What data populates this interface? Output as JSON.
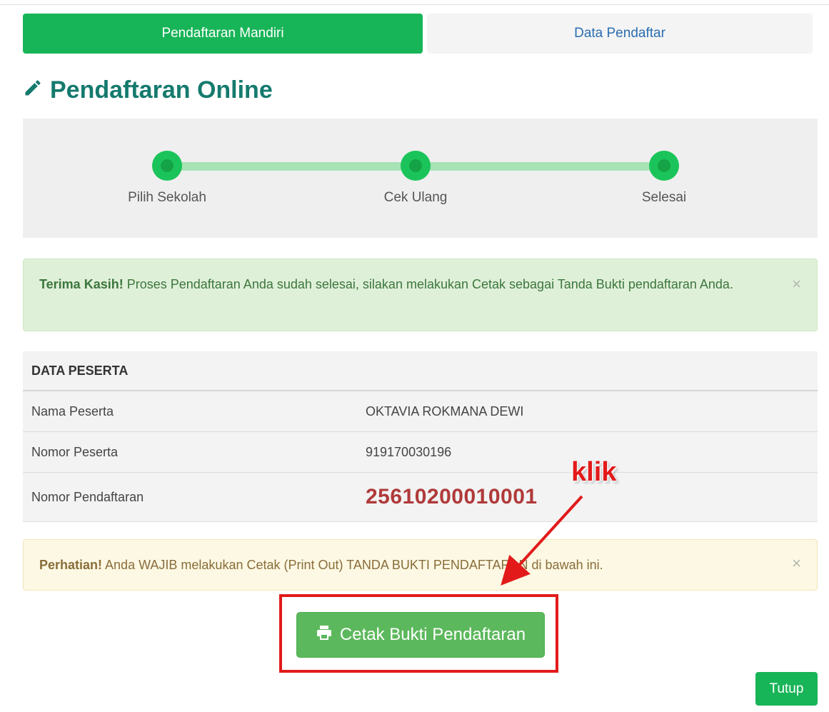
{
  "tabs": [
    {
      "label": "Pendaftaran Mandiri",
      "active": true
    },
    {
      "label": "Data Pendaftar",
      "active": false
    }
  ],
  "page_title": "Pendaftaran Online",
  "page_title_icon": "pencil-icon",
  "steps": [
    {
      "label": "Pilih Sekolah",
      "done": true
    },
    {
      "label": "Cek Ulang",
      "done": true
    },
    {
      "label": "Selesai",
      "done": true
    }
  ],
  "alert_success": {
    "strong": "Terima Kasih!",
    "text": " Proses Pendaftaran Anda sudah selesai, silakan melakukan Cetak sebagai Tanda Bukti pendaftaran Anda.",
    "close": "×"
  },
  "participant_table": {
    "header": "DATA PESERTA",
    "rows": [
      {
        "label": "Nama Peserta",
        "value": "OKTAVIA ROKMANA DEWI"
      },
      {
        "label": "Nomor Peserta",
        "value": "919170030196"
      },
      {
        "label": "Nomor Pendaftaran",
        "value": "25610200010001"
      }
    ]
  },
  "alert_warning": {
    "strong": "Perhatian!",
    "text": " Anda WAJIB melakukan Cetak (Print Out) TANDA BUKTI PENDAFTARAN di bawah ini.",
    "close": "×"
  },
  "print_button": {
    "label": "Cetak Bukti Pendaftaran",
    "icon": "printer-icon"
  },
  "annotation": {
    "text": "klik"
  },
  "close_button": {
    "label": "Tutup"
  },
  "colors": {
    "primary_green": "#18b458",
    "title_teal": "#157a6e",
    "step_dot": "#1bc45a",
    "step_line": "#a7e3b5",
    "registration_number": "#b03a3a",
    "annotation_red": "#e21a1a"
  }
}
